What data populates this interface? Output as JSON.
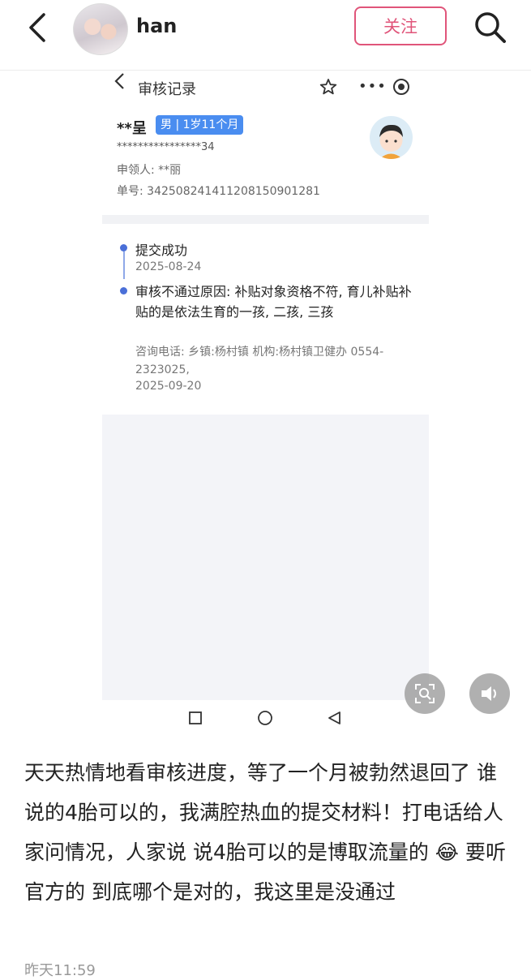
{
  "header": {
    "username": "han",
    "follow_label": "关注",
    "back_icon": "chevron-left-icon",
    "search_icon": "search-icon"
  },
  "embedded": {
    "nav_title": "审核记录",
    "more": "•••",
    "name": "**呈",
    "tag": "男 | 1岁11个月",
    "id_number": "****************34",
    "applicant": "申领人: **丽",
    "order_number": "单号: 342508241411208150901281",
    "timeline": [
      {
        "title": "提交成功",
        "date": "2025-08-24"
      },
      {
        "title": "审核不通过原因: 补贴对象资格不符, 育儿补贴补贴的是依法生育的一孩, 二孩, 三孩",
        "contact": "咨询电话: 乡镇:杨村镇 机构:杨村镇卫健办 0554-2323025,",
        "date": "2025-09-20"
      }
    ]
  },
  "caption": "天天热情地看审核进度，等了一个月被勃然退回了    谁说的4胎可以的，我满腔热血的提交材料！打电话给人家问情况，人家说  说4胎可以的是博取流量的 😂  要听官方的   到底哪个是对的，我这里是没通过",
  "timestamp": "昨天11:59",
  "colors": {
    "accent": "#e0557a",
    "tag_bg": "#4a8df0",
    "timeline_dot": "#4a6fd8"
  }
}
